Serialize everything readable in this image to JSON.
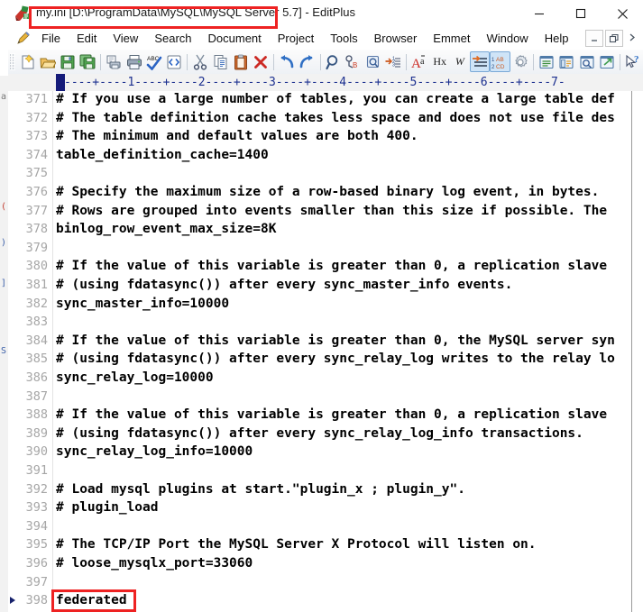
{
  "window": {
    "title": "my.ini [D:\\ProgramData\\MySQL\\MySQL Server 5.7] - EditPlus",
    "app_icon": "editplus-icon",
    "controls": [
      {
        "name": "minimize-button",
        "glyph": "minimize-icon"
      },
      {
        "name": "maximize-button",
        "glyph": "maximize-icon"
      },
      {
        "name": "close-button",
        "glyph": "close-icon"
      }
    ]
  },
  "menubar": {
    "pencil_icon": "pencil-icon",
    "items": [
      {
        "label": "File"
      },
      {
        "label": "Edit"
      },
      {
        "label": "View"
      },
      {
        "label": "Search"
      },
      {
        "label": "Document"
      },
      {
        "label": "Project"
      },
      {
        "label": "Tools"
      },
      {
        "label": "Browser"
      },
      {
        "label": "Emmet"
      },
      {
        "label": "Window"
      },
      {
        "label": "Help"
      }
    ],
    "mdi_controls": [
      {
        "name": "mdi-minimize-button",
        "label": "–"
      },
      {
        "name": "mdi-restore-button",
        "label": "❐"
      },
      {
        "name": "mdi-close-button",
        "label": "»"
      }
    ]
  },
  "toolbar": {
    "buttons": [
      {
        "name": "new-file-button",
        "icon": "new-document-icon"
      },
      {
        "name": "open-file-button",
        "icon": "open-folder-icon"
      },
      {
        "name": "save-file-button",
        "icon": "floppy-save-icon"
      },
      {
        "name": "save-all-button",
        "icon": "save-all-icon"
      },
      {
        "name": "print-preview-button",
        "icon": "print-preview-icon"
      },
      {
        "name": "print-button",
        "icon": "printer-icon"
      },
      {
        "name": "spell-check-button",
        "icon": "abc-spellcheck-icon"
      },
      {
        "name": "view-in-browser-button",
        "icon": "html-tag-icon"
      },
      {
        "name": "cut-button",
        "icon": "scissors-icon"
      },
      {
        "name": "copy-button",
        "icon": "copy-icon"
      },
      {
        "name": "paste-button",
        "icon": "clipboard-paste-icon"
      },
      {
        "name": "delete-button",
        "icon": "red-x-icon"
      },
      {
        "name": "undo-button",
        "icon": "undo-arrow-icon"
      },
      {
        "name": "redo-button",
        "icon": "redo-arrow-icon"
      },
      {
        "name": "find-button",
        "icon": "magnifier-icon"
      },
      {
        "name": "find-next-button",
        "icon": "find-next-icon"
      },
      {
        "name": "goto-button",
        "icon": "goto-icon"
      },
      {
        "name": "toggle-bookmark-button",
        "icon": "bookmark-list-icon"
      },
      {
        "name": "match-case-button",
        "icon": "letter-a-icon",
        "label": "A"
      },
      {
        "name": "hex-view-button",
        "icon": "hex-icon",
        "label": "Hx"
      },
      {
        "name": "word-wrap-button",
        "icon": "word-wrap-icon",
        "label": "W"
      },
      {
        "name": "indent-button",
        "icon": "indent-arrow-icon",
        "active": true
      },
      {
        "name": "sort-lines-button",
        "icon": "sort-ab-cd-icon",
        "active": true
      },
      {
        "name": "preferences-button",
        "icon": "gear-icon"
      },
      {
        "name": "document-selector-button",
        "icon": "document-list-icon"
      },
      {
        "name": "directory-window-button",
        "icon": "directory-icon"
      },
      {
        "name": "clip-library-button",
        "icon": "cliptext-icon"
      },
      {
        "name": "user-tool-button",
        "icon": "external-window-icon"
      },
      {
        "name": "context-help-button",
        "icon": "help-pointer-icon"
      }
    ]
  },
  "ruler": {
    "ticks": "----+----1----+----2----+----3----+----4----+----5----+----6----+----7-",
    "caret_column_marker": "column-caret"
  },
  "editor": {
    "current_line": 398,
    "lines": [
      {
        "n": "371",
        "text": "# If you use a large number of tables, you can create a large table def"
      },
      {
        "n": "372",
        "text": "# The table definition cache takes less space and does not use file des"
      },
      {
        "n": "373",
        "text": "# The minimum and default values are both 400."
      },
      {
        "n": "374",
        "text": "table_definition_cache=1400"
      },
      {
        "n": "375",
        "text": ""
      },
      {
        "n": "376",
        "text": "# Specify the maximum size of a row-based binary log event, in bytes."
      },
      {
        "n": "377",
        "text": "# Rows are grouped into events smaller than this size if possible. The"
      },
      {
        "n": "378",
        "text": "binlog_row_event_max_size=8K"
      },
      {
        "n": "379",
        "text": ""
      },
      {
        "n": "380",
        "text": "# If the value of this variable is greater than 0, a replication slave"
      },
      {
        "n": "381",
        "text": "# (using fdatasync()) after every sync_master_info events."
      },
      {
        "n": "382",
        "text": "sync_master_info=10000"
      },
      {
        "n": "383",
        "text": ""
      },
      {
        "n": "384",
        "text": "# If the value of this variable is greater than 0, the MySQL server syn"
      },
      {
        "n": "385",
        "text": "# (using fdatasync()) after every sync_relay_log writes to the relay lo"
      },
      {
        "n": "386",
        "text": "sync_relay_log=10000"
      },
      {
        "n": "387",
        "text": ""
      },
      {
        "n": "388",
        "text": "# If the value of this variable is greater than 0, a replication slave"
      },
      {
        "n": "389",
        "text": "# (using fdatasync()) after every sync_relay_log_info transactions."
      },
      {
        "n": "390",
        "text": "sync_relay_log_info=10000"
      },
      {
        "n": "391",
        "text": ""
      },
      {
        "n": "392",
        "text": "# Load mysql plugins at start.\"plugin_x ; plugin_y\"."
      },
      {
        "n": "393",
        "text": "# plugin_load"
      },
      {
        "n": "394",
        "text": ""
      },
      {
        "n": "395",
        "text": "# The TCP/IP Port the MySQL Server X Protocol will listen on."
      },
      {
        "n": "396",
        "text": "# loose_mysqlx_port=33060"
      },
      {
        "n": "397",
        "text": ""
      },
      {
        "n": "398",
        "text": "federated"
      }
    ]
  },
  "annotations": [
    {
      "name": "title-highlight-box",
      "target": "window title",
      "color": "#ee2222"
    },
    {
      "name": "federated-highlight-box",
      "target": "line 398 federated",
      "color": "#ee2222"
    }
  ],
  "background_window": {
    "fragments": [
      "a",
      "(",
      ")",
      "]",
      "S"
    ]
  },
  "colors": {
    "annotation_red": "#ee2222",
    "ruler_blue": "#1b2f8f",
    "caret_block": "#151b7a",
    "line_number": "#a6a6a6",
    "code_text": "#000000",
    "toolbar_active": "#cfe4f7"
  }
}
